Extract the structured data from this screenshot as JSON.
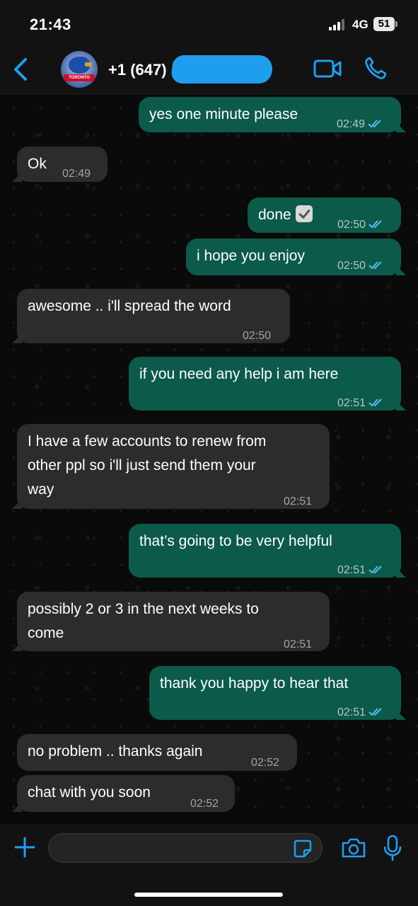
{
  "status_bar": {
    "time": "21:43",
    "network": "4G",
    "battery": "51"
  },
  "header": {
    "contact": "+1 (647)"
  },
  "colors": {
    "accent": "#1f9ef0",
    "outgoing": "#0b5a4a",
    "incoming": "#2c2c2e",
    "read_ticks": "#53bdeb"
  },
  "messages": [
    {
      "dir": "out",
      "text": "yes one minute please",
      "time": "02:49",
      "read": true
    },
    {
      "dir": "in",
      "text": "Ok",
      "time": "02:49"
    },
    {
      "dir": "out",
      "text": "done",
      "emoji": "check-mark-button",
      "time": "02:50",
      "read": true
    },
    {
      "dir": "out",
      "text": "i hope you enjoy",
      "time": "02:50",
      "read": true
    },
    {
      "dir": "in",
      "text": "awesome .. i'll spread the word",
      "time": "02:50"
    },
    {
      "dir": "out",
      "text": "if you need any help i am here",
      "time": "02:51",
      "read": true
    },
    {
      "dir": "in",
      "text": "I have a few accounts to renew from\nother ppl so i'll just send them your\nway",
      "time": "02:51"
    },
    {
      "dir": "out",
      "text": "that’s going to be very helpful",
      "time": "02:51",
      "read": true
    },
    {
      "dir": "in",
      "text": "possibly 2 or 3 in the next weeks to\ncome",
      "time": "02:51"
    },
    {
      "dir": "out",
      "text": "thank you happy to hear that",
      "time": "02:51",
      "read": true
    },
    {
      "dir": "in",
      "text": "no problem .. thanks again",
      "time": "02:52"
    },
    {
      "dir": "in",
      "text": "chat with you soon",
      "time": "02:52"
    }
  ],
  "input": {
    "value": ""
  }
}
